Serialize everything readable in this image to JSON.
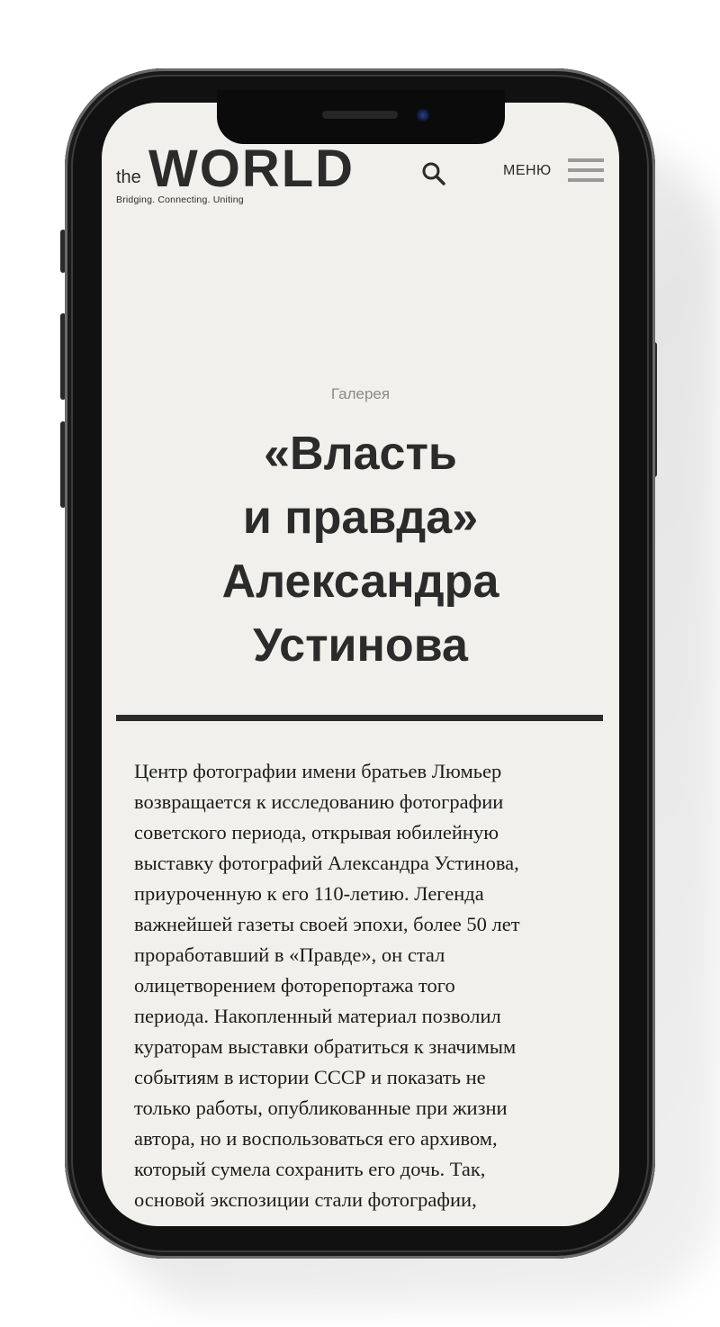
{
  "header": {
    "logo": {
      "prefix": "the",
      "word": "WORLD",
      "tagline": "Bridging. Connecting. Uniting"
    },
    "search_icon": "search-icon",
    "menu_label": "МЕНЮ",
    "menu_icon": "hamburger-icon"
  },
  "article": {
    "category": "Галерея",
    "title_lines": [
      "«Власть",
      "и правда»",
      "Александра",
      "Устинова"
    ],
    "body_lines": [
      "Центр фотографии имени братьев Люмьер",
      "возвращается к исследованию фотографии",
      "советского периода, открывая юбилейную",
      "выставку фотографий Александра Устинова,",
      "приуроченную к его 110-летию. Легенда",
      "важнейшей газеты своей эпохи, более 50 лет",
      "проработавший в «Правде», он стал",
      "олицетворением фоторепортажа того",
      "периода. Накопленный материал позволил",
      "кураторам выставки обратиться к значимым",
      "событиям в истории СССР и показать не",
      "только работы, опубликованные при жизни",
      "автора, но и воспользоваться его архивом,",
      "который сумела сохранить его дочь. Так,",
      "основой экспозиции стали фотографии,"
    ]
  },
  "colors": {
    "background": "#f1f0ec",
    "text": "#2b2b2b",
    "muted": "#8a8a8a",
    "phone_frame": "#111111"
  }
}
